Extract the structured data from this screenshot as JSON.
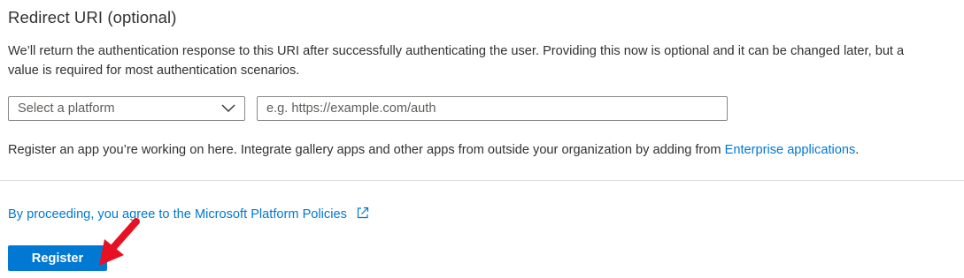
{
  "redirect_section": {
    "title": "Redirect URI (optional)",
    "description": "We’ll return the authentication response to this URI after successfully authenticating the user. Providing this now is optional and it can be changed later, but a value is required for most authentication scenarios.",
    "platform_select": {
      "placeholder": "Select a platform",
      "icon": "chevron-down-icon"
    },
    "uri_input": {
      "value": "",
      "placeholder": "e.g. https://example.com/auth"
    }
  },
  "register_note": {
    "text": "Register an app you’re working on here. Integrate gallery apps and other apps from outside your organization by adding from ",
    "link_label": "Enterprise applications",
    "suffix": "."
  },
  "policy": {
    "link_label": "By proceeding, you agree to the Microsoft Platform Policies",
    "icon": "external-link-icon"
  },
  "actions": {
    "register_label": "Register"
  },
  "annotation": {
    "icon": "red-arrow-icon"
  },
  "colors": {
    "accent": "#0078d4",
    "text": "#323130",
    "placeholder": "#605e5c",
    "border": "#8a8886",
    "divider": "#e1dfdd",
    "annotation": "#e81123"
  }
}
